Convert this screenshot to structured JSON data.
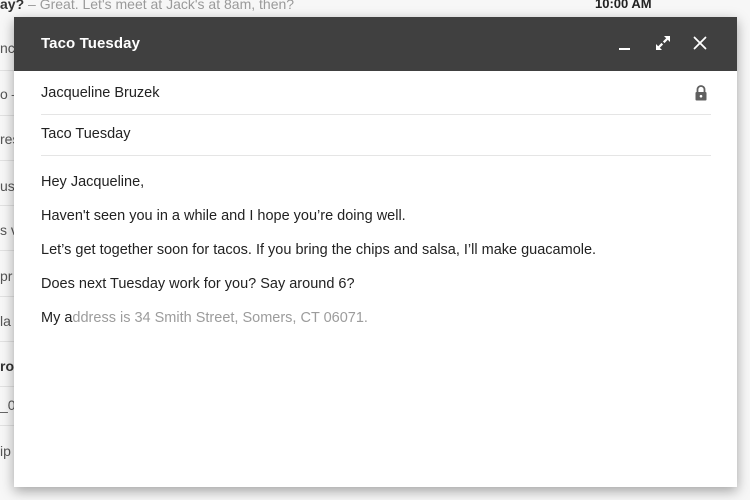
{
  "background": {
    "top_subject": "ay?",
    "top_preview": " – Great. Let's meet at Jack's at 8am, then?",
    "top_time": "10:00 AM",
    "fragments": [
      "nc",
      "o –",
      "res",
      "us",
      "s v",
      "pr",
      "la",
      "ro",
      "_0",
      "ip"
    ]
  },
  "compose": {
    "title": "Taco Tuesday",
    "recipient": "Jacqueline Bruzek",
    "subject": "Taco Tuesday",
    "body": {
      "greeting": "Hey Jacqueline,",
      "line1": "Haven't seen you in a while and I hope you’re doing well.",
      "line2": "Let’s get together soon for tacos. If you bring the chips and salsa, I’ll make guacamole.",
      "line3": "Does next Tuesday work for you? Say around 6?",
      "typed": "My a",
      "suggestion": "ddress is 34 Smith Street, Somers, CT 06071."
    }
  },
  "icons": {
    "minimize": "minimize-icon",
    "expand": "expand-icon",
    "close": "close-icon",
    "lock": "lock-icon"
  }
}
